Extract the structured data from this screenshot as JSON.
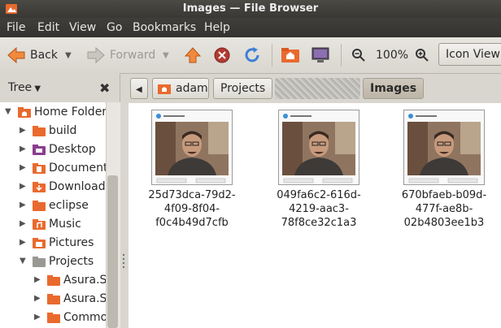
{
  "window": {
    "title": "Images — File Browser"
  },
  "menu": [
    "File",
    "Edit",
    "View",
    "Go",
    "Bookmarks",
    "Help"
  ],
  "toolbar": {
    "back_label": "Back",
    "forward_label": "Forward",
    "zoom_level": "100%",
    "view_mode": "Icon View"
  },
  "sidebar": {
    "header_label": "Tree",
    "items": [
      {
        "label": "Home Folder",
        "expanded": true,
        "level": 0,
        "icon": "home-folder-icon"
      },
      {
        "label": "build",
        "expanded": false,
        "level": 1,
        "icon": "folder-icon"
      },
      {
        "label": "Desktop",
        "expanded": false,
        "level": 1,
        "icon": "desktop-folder-icon"
      },
      {
        "label": "Documents",
        "expanded": false,
        "level": 1,
        "icon": "documents-folder-icon"
      },
      {
        "label": "Downloads",
        "expanded": false,
        "level": 1,
        "icon": "downloads-folder-icon"
      },
      {
        "label": "eclipse",
        "expanded": false,
        "level": 1,
        "icon": "folder-icon"
      },
      {
        "label": "Music",
        "expanded": false,
        "level": 1,
        "icon": "music-folder-icon"
      },
      {
        "label": "Pictures",
        "expanded": false,
        "level": 1,
        "icon": "pictures-folder-icon"
      },
      {
        "label": "Projects",
        "expanded": true,
        "level": 1,
        "icon": "folder-open-icon"
      },
      {
        "label": "Asura.St",
        "expanded": false,
        "level": 2,
        "icon": "folder-icon"
      },
      {
        "label": "Asura.Sy",
        "expanded": false,
        "level": 2,
        "icon": "folder-icon"
      },
      {
        "label": "Commo",
        "expanded": false,
        "level": 2,
        "icon": "folder-icon"
      }
    ]
  },
  "pathbar": {
    "segments": [
      "adam",
      "Projects",
      "Images"
    ]
  },
  "files": [
    {
      "name": "25d73dca-79d2-4f09-8f04-f0c4b49d7cfb"
    },
    {
      "name": "049fa6c2-616d-4219-aac3-78f8ce32c1a3"
    },
    {
      "name": "670bfaeb-b09d-477f-ae8b-02b4803ee1b3"
    }
  ],
  "colors": {
    "titlebar": "#3f3e3a",
    "folder_orange": "#e96a2e",
    "selection": "#c4bcae"
  }
}
